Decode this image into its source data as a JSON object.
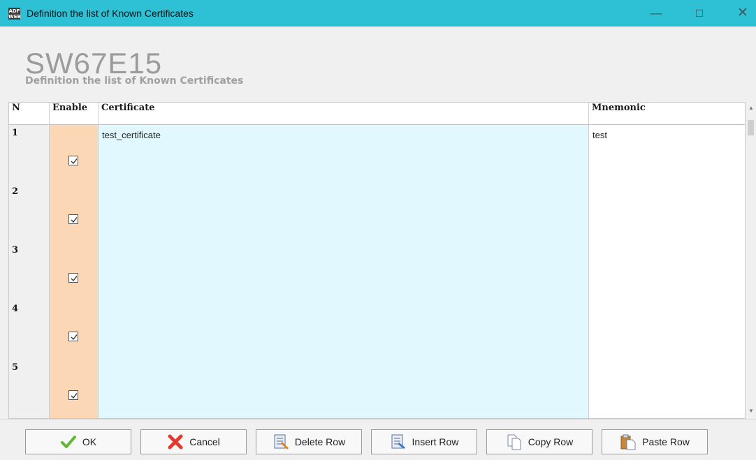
{
  "window": {
    "title": "Definition the list of Known Certificates",
    "app_icon_text": "ADF WEB",
    "controls": {
      "minimize": "—",
      "maximize": "☐",
      "close": "✕"
    }
  },
  "header": {
    "product": "SW67E15",
    "subtitle": "Definition the list of Known Certificates"
  },
  "table": {
    "columns": [
      "N",
      "Enable",
      "Certificate",
      "Mnemonic"
    ],
    "rows": [
      {
        "n": "1",
        "enabled": true,
        "certificate": "test_certificate",
        "mnemonic": "test"
      },
      {
        "n": "2",
        "enabled": true,
        "certificate": "",
        "mnemonic": ""
      },
      {
        "n": "3",
        "enabled": true,
        "certificate": "",
        "mnemonic": ""
      },
      {
        "n": "4",
        "enabled": true,
        "certificate": "",
        "mnemonic": ""
      },
      {
        "n": "5",
        "enabled": true,
        "certificate": "",
        "mnemonic": ""
      }
    ]
  },
  "toolbar": {
    "ok": "OK",
    "cancel": "Cancel",
    "delete_row": "Delete Row",
    "insert_row": "Insert Row",
    "copy_row": "Copy Row",
    "paste_row": "Paste Row"
  },
  "colors": {
    "titlebar": "#2ec0d4",
    "enable_column": "#fbd7b6",
    "certificate_column": "#e1f9fe"
  }
}
